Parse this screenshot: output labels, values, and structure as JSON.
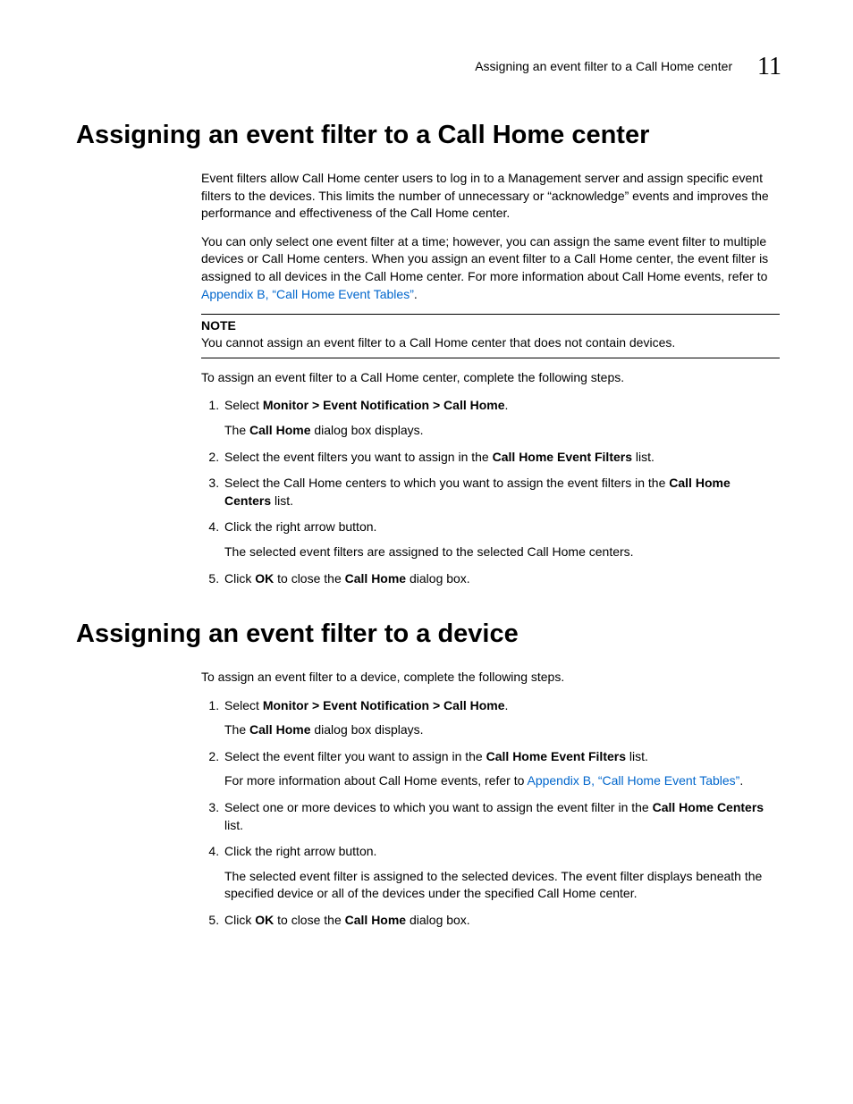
{
  "header": {
    "running_title": "Assigning an event filter to a Call Home center",
    "page_number": "11"
  },
  "section1": {
    "title": "Assigning an event filter to a Call Home center",
    "para1": "Event filters allow Call Home center users to log in to a Management server and assign specific event filters to the devices. This limits the number of unnecessary or “acknowledge” events and improves the performance and effectiveness of the Call Home center.",
    "para2a": "You can only select one event filter at a time; however, you can assign the same event filter to multiple devices or Call Home centers. When you assign an event filter to a Call Home center, the event filter is assigned to all devices in the Call Home center. For more information about Call Home events, refer to ",
    "para2_link": "Appendix B, “Call Home Event Tables”",
    "para2b": ".",
    "note_label": "NOTE",
    "note_text": "You cannot assign an event filter to a Call Home center that does not contain devices.",
    "para3": "To assign an event filter to a Call Home center, complete the following steps.",
    "steps": {
      "s1a": "Select ",
      "s1b": "Monitor > Event Notification > Call Home",
      "s1c": ".",
      "s1_sub_a": "The ",
      "s1_sub_b": "Call Home",
      "s1_sub_c": " dialog box displays.",
      "s2a": "Select the event filters you want to assign in the ",
      "s2b": "Call Home Event Filters",
      "s2c": " list.",
      "s3a": "Select the Call Home centers to which you want to assign the event filters in the ",
      "s3b": "Call Home Centers",
      "s3c": " list.",
      "s4": "Click the right arrow button.",
      "s4_sub": "The selected event filters are assigned to the selected Call Home centers.",
      "s5a": "Click ",
      "s5b": "OK",
      "s5c": " to close the ",
      "s5d": "Call Home",
      "s5e": " dialog box."
    }
  },
  "section2": {
    "title": "Assigning an event filter to a device",
    "para1": "To assign an event filter to a device, complete the following steps.",
    "steps": {
      "s1a": "Select ",
      "s1b": "Monitor > Event Notification > Call Home",
      "s1c": ".",
      "s1_sub_a": "The ",
      "s1_sub_b": "Call Home",
      "s1_sub_c": " dialog box displays.",
      "s2a": "Select the event filter you want to assign in the ",
      "s2b": "Call Home Event Filters",
      "s2c": " list.",
      "s2_sub_a": "For more information about Call Home events, refer to ",
      "s2_sub_link": "Appendix B, “Call Home Event Tables”",
      "s2_sub_b": ".",
      "s3a": "Select one or more devices to which you want to assign the event filter in the ",
      "s3b": "Call Home Centers",
      "s3c": " list.",
      "s4": "Click the right arrow button.",
      "s4_sub": "The selected event filter is assigned to the selected devices. The event filter displays beneath the specified device or all of the devices under the specified Call Home center.",
      "s5a": "Click ",
      "s5b": "OK",
      "s5c": " to close the ",
      "s5d": "Call Home",
      "s5e": " dialog box."
    }
  }
}
